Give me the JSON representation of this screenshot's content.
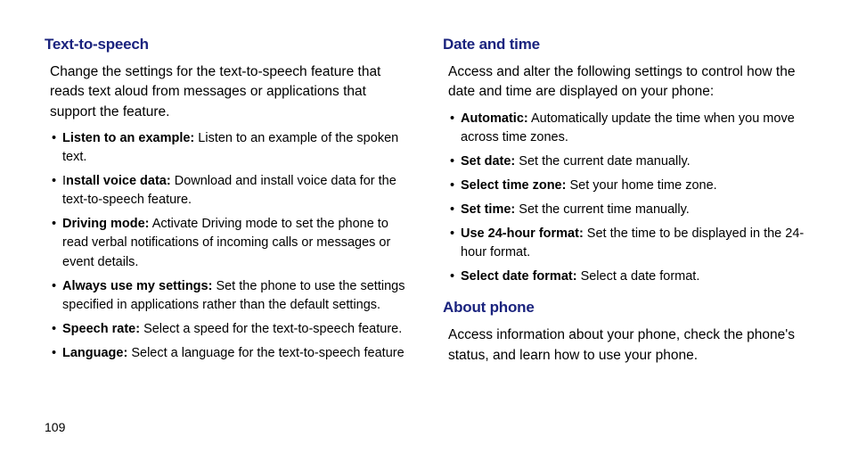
{
  "page_number": "109",
  "left": {
    "section1": {
      "heading": "Text-to-speech",
      "intro": "Change the settings for the text-to-speech feature that reads text aloud from messages or applications that support the feature.",
      "items": [
        {
          "label": "Listen to an example:",
          "text": " Listen to an example of the spoken text."
        },
        {
          "label_prefix": "I",
          "label": "nstall voice data:",
          "text": " Download and install voice data for the text-to-speech feature."
        },
        {
          "label": "Driving mode:",
          "text": " Activate Driving mode to set the phone to read verbal notifications of incoming calls or messages or event details."
        },
        {
          "label": "Always use my settings:",
          "text": " Set the phone to use the settings specified in applications rather than the default settings."
        },
        {
          "label": "Speech rate:",
          "text": " Select a speed for the text-to-speech feature."
        },
        {
          "label": "Language:",
          "text": " Select a language for the text-to-speech feature"
        }
      ]
    }
  },
  "right": {
    "section1": {
      "heading": "Date and time",
      "intro": "Access and alter the following settings to control how the date and time are displayed on your phone:",
      "items": [
        {
          "label": "Automatic:",
          "text": " Automatically update the time when you move across time zones."
        },
        {
          "label": "Set date:",
          "text": " Set the current date manually."
        },
        {
          "label": "Select time zone:",
          "text": " Set your home time zone."
        },
        {
          "label": "Set time:",
          "text": " Set the current time manually."
        },
        {
          "label": "Use 24-hour format:",
          "text": " Set the time to be displayed in the 24-hour format."
        },
        {
          "label": "Select date format:",
          "text": " Select a date format."
        }
      ]
    },
    "section2": {
      "heading": "About phone",
      "intro": "Access information about your phone, check the phone's status, and learn how to use your phone."
    }
  }
}
